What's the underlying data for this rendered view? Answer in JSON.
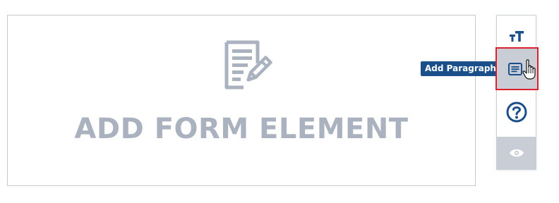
{
  "canvas": {
    "label": "ADD FORM ELEMENT",
    "icon": "form-edit-icon"
  },
  "toolbar": {
    "items": [
      {
        "name": "heading",
        "icon": "text-size-icon",
        "selected": false
      },
      {
        "name": "paragraph",
        "icon": "paragraph-icon",
        "selected": true,
        "tooltip": "Add Paragraph"
      },
      {
        "name": "help",
        "icon": "question-icon",
        "selected": false
      },
      {
        "name": "preview",
        "icon": "eye-icon",
        "selected": false
      }
    ]
  },
  "colors": {
    "accent": "#1b4f8c",
    "selection_border": "#d9222d",
    "muted": "#aab2bf",
    "tool_bg": "#c8cdd6"
  }
}
